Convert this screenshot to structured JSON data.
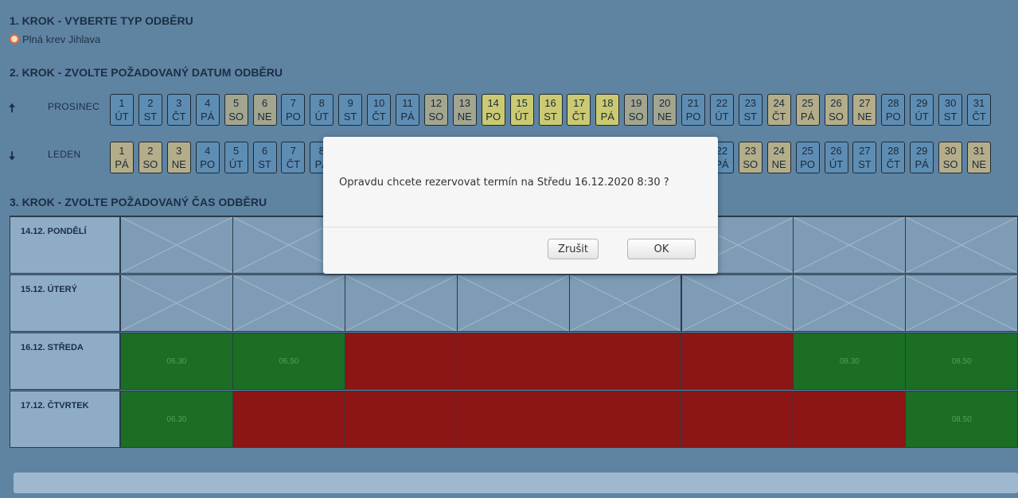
{
  "step1": {
    "title": "1. KROK - VYBERTE TYP ODBĚRU",
    "option_label": "Plná krev Jihlava"
  },
  "step2": {
    "title": "2. KROK - ZVOLTE POŽADOVANÝ DATUM ODBĚRU",
    "months": [
      {
        "name": "PROSINEC",
        "arrow": "🠅",
        "days": [
          {
            "n": "1",
            "d": "ÚT",
            "c": "blue"
          },
          {
            "n": "2",
            "d": "ST",
            "c": "blue"
          },
          {
            "n": "3",
            "d": "ČT",
            "c": "blue"
          },
          {
            "n": "4",
            "d": "PÁ",
            "c": "blue"
          },
          {
            "n": "5",
            "d": "SO",
            "c": "grey"
          },
          {
            "n": "6",
            "d": "NE",
            "c": "grey"
          },
          {
            "n": "7",
            "d": "PO",
            "c": "blue"
          },
          {
            "n": "8",
            "d": "ÚT",
            "c": "blue"
          },
          {
            "n": "9",
            "d": "ST",
            "c": "blue"
          },
          {
            "n": "10",
            "d": "ČT",
            "c": "blue"
          },
          {
            "n": "11",
            "d": "PÁ",
            "c": "blue"
          },
          {
            "n": "12",
            "d": "SO",
            "c": "grey"
          },
          {
            "n": "13",
            "d": "NE",
            "c": "grey"
          },
          {
            "n": "14",
            "d": "PO",
            "c": "yellow"
          },
          {
            "n": "15",
            "d": "ÚT",
            "c": "yellow"
          },
          {
            "n": "16",
            "d": "ST",
            "c": "yellow"
          },
          {
            "n": "17",
            "d": "ČT",
            "c": "yellow"
          },
          {
            "n": "18",
            "d": "PÁ",
            "c": "yellow"
          },
          {
            "n": "19",
            "d": "SO",
            "c": "grey"
          },
          {
            "n": "20",
            "d": "NE",
            "c": "grey"
          },
          {
            "n": "21",
            "d": "PO",
            "c": "blue"
          },
          {
            "n": "22",
            "d": "ÚT",
            "c": "blue"
          },
          {
            "n": "23",
            "d": "ST",
            "c": "blue"
          },
          {
            "n": "24",
            "d": "ČT",
            "c": "tan"
          },
          {
            "n": "25",
            "d": "PÁ",
            "c": "tan"
          },
          {
            "n": "26",
            "d": "SO",
            "c": "tan"
          },
          {
            "n": "27",
            "d": "NE",
            "c": "tan"
          },
          {
            "n": "28",
            "d": "PO",
            "c": "blue"
          },
          {
            "n": "29",
            "d": "ÚT",
            "c": "blue"
          },
          {
            "n": "30",
            "d": "ST",
            "c": "blue"
          },
          {
            "n": "31",
            "d": "ČT",
            "c": "blue"
          }
        ]
      },
      {
        "name": "LEDEN",
        "arrow": "🠇",
        "days": [
          {
            "n": "1",
            "d": "PÁ",
            "c": "tan"
          },
          {
            "n": "2",
            "d": "SO",
            "c": "tan"
          },
          {
            "n": "3",
            "d": "NE",
            "c": "tan"
          },
          {
            "n": "4",
            "d": "PO",
            "c": "blue"
          },
          {
            "n": "5",
            "d": "ÚT",
            "c": "blue"
          },
          {
            "n": "6",
            "d": "ST",
            "c": "blue"
          },
          {
            "n": "7",
            "d": "ČT",
            "c": "blue"
          },
          {
            "n": "8",
            "d": "PÁ",
            "c": "blue"
          },
          {
            "n": "22",
            "d": "PÁ",
            "c": "blue",
            "col": 21
          },
          {
            "n": "23",
            "d": "SO",
            "c": "tan"
          },
          {
            "n": "24",
            "d": "NE",
            "c": "tan"
          },
          {
            "n": "25",
            "d": "PO",
            "c": "blue"
          },
          {
            "n": "26",
            "d": "ÚT",
            "c": "blue"
          },
          {
            "n": "27",
            "d": "ST",
            "c": "blue"
          },
          {
            "n": "28",
            "d": "ČT",
            "c": "blue"
          },
          {
            "n": "29",
            "d": "PÁ",
            "c": "blue"
          },
          {
            "n": "30",
            "d": "SO",
            "c": "tan"
          },
          {
            "n": "31",
            "d": "NE",
            "c": "tan"
          }
        ]
      }
    ]
  },
  "step3": {
    "title": "3. KROK - ZVOLTE POŽADOVANÝ ČAS ODBĚRU",
    "rows": [
      {
        "label": "14.12. PONDĚLÍ",
        "cells": [
          {
            "s": "x"
          },
          {
            "s": "x"
          },
          {
            "s": "x"
          },
          {
            "s": "x"
          },
          {
            "s": "x"
          },
          {
            "s": "x"
          },
          {
            "s": "x"
          },
          {
            "s": "x"
          }
        ]
      },
      {
        "label": "15.12. ÚTERÝ",
        "cells": [
          {
            "s": "x"
          },
          {
            "s": "x"
          },
          {
            "s": "x"
          },
          {
            "s": "x"
          },
          {
            "s": "x"
          },
          {
            "s": "x"
          },
          {
            "s": "x"
          },
          {
            "s": "x"
          }
        ]
      },
      {
        "label": "16.12. STŘEDA",
        "cells": [
          {
            "s": "green",
            "t": "06.30"
          },
          {
            "s": "green",
            "t": "06.50"
          },
          {
            "s": "red"
          },
          {
            "s": "red"
          },
          {
            "s": "red"
          },
          {
            "s": "red"
          },
          {
            "s": "green",
            "t": "08.30"
          },
          {
            "s": "green",
            "t": "08.50"
          }
        ]
      },
      {
        "label": "17.12. ČTVRTEK",
        "cells": [
          {
            "s": "green",
            "t": "06.30"
          },
          {
            "s": "red"
          },
          {
            "s": "red"
          },
          {
            "s": "red"
          },
          {
            "s": "red"
          },
          {
            "s": "red"
          },
          {
            "s": "red"
          },
          {
            "s": "green",
            "t": "08.50"
          }
        ]
      }
    ]
  },
  "dialog": {
    "message": "Opravdu chcete rezervovat termín na Středu 16.12.2020 8:30 ?",
    "cancel_label": "Zrušit",
    "ok_label": "OK"
  },
  "colors": {
    "accent_radio": "#e96b2b",
    "available": "#1b6e24",
    "booked": "#8c1616"
  }
}
